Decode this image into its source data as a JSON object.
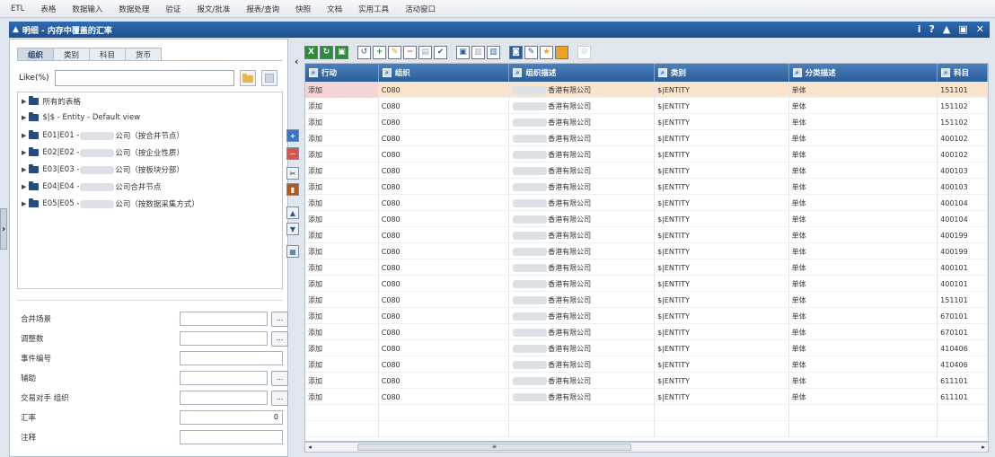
{
  "menu": [
    "ETL",
    "表格",
    "数据输入",
    "数据处理",
    "验证",
    "报文/批准",
    "报表/查询",
    "快照",
    "文档",
    "实用工具",
    "活动窗口"
  ],
  "panel": {
    "title": "明细 - 内存中覆盖的汇率",
    "tools": [
      "i",
      "?",
      "▲",
      "▣",
      "✕"
    ]
  },
  "left": {
    "tabs": [
      "组织",
      "类别",
      "科目",
      "货币"
    ],
    "like_label": "Like(%)",
    "like_value": "",
    "tree": [
      {
        "label": "所有的表格",
        "blur": false,
        "suffix": ""
      },
      {
        "label": "$|$ - Entity - Default view",
        "blur": false,
        "suffix": ""
      },
      {
        "label": "E01|E01 -",
        "blur": true,
        "suffix": "公司（按合并节点）"
      },
      {
        "label": "E02|E02 -",
        "blur": true,
        "suffix": "公司（按企业性质）"
      },
      {
        "label": "E03|E03 -",
        "blur": true,
        "suffix": "公司（按板块分部）"
      },
      {
        "label": "E04|E04 -",
        "blur": true,
        "suffix": "公司合并节点"
      },
      {
        "label": "E05|E05 -",
        "blur": true,
        "suffix": "公司（按数据采集方式）"
      }
    ],
    "fields": [
      {
        "label": "合并场景",
        "value": "",
        "lookup": "..."
      },
      {
        "label": "调整数",
        "value": "",
        "lookup": "..."
      },
      {
        "label": "事件编号",
        "value": "",
        "lookup": ""
      },
      {
        "label": "辅助",
        "value": "",
        "lookup": "..."
      },
      {
        "label": "交易对手 组织",
        "value": "",
        "lookup": "..."
      },
      {
        "label": "汇率",
        "value": "0",
        "lookup": ""
      },
      {
        "label": "注释",
        "value": "",
        "lookup": ""
      }
    ]
  },
  "grid": {
    "columns": [
      "行动",
      "组织",
      "组织描述",
      "类别",
      "分类描述",
      "科目"
    ],
    "rows": [
      {
        "action": "添加",
        "org": "C080",
        "desc": "香港有限公司",
        "cat": "$|ENTITY",
        "cdesc": "单体",
        "acct": "151101"
      },
      {
        "action": "添加",
        "org": "C080",
        "desc": "香港有限公司",
        "cat": "$|ENTITY",
        "cdesc": "单体",
        "acct": "151102"
      },
      {
        "action": "添加",
        "org": "C080",
        "desc": "香港有限公司",
        "cat": "$|ENTITY",
        "cdesc": "单体",
        "acct": "151102"
      },
      {
        "action": "添加",
        "org": "C080",
        "desc": "香港有限公司",
        "cat": "$|ENTITY",
        "cdesc": "单体",
        "acct": "400102"
      },
      {
        "action": "添加",
        "org": "C080",
        "desc": "香港有限公司",
        "cat": "$|ENTITY",
        "cdesc": "单体",
        "acct": "400102"
      },
      {
        "action": "添加",
        "org": "C080",
        "desc": "香港有限公司",
        "cat": "$|ENTITY",
        "cdesc": "单体",
        "acct": "400103"
      },
      {
        "action": "添加",
        "org": "C080",
        "desc": "香港有限公司",
        "cat": "$|ENTITY",
        "cdesc": "单体",
        "acct": "400103"
      },
      {
        "action": "添加",
        "org": "C080",
        "desc": "香港有限公司",
        "cat": "$|ENTITY",
        "cdesc": "单体",
        "acct": "400104"
      },
      {
        "action": "添加",
        "org": "C080",
        "desc": "香港有限公司",
        "cat": "$|ENTITY",
        "cdesc": "单体",
        "acct": "400104"
      },
      {
        "action": "添加",
        "org": "C080",
        "desc": "香港有限公司",
        "cat": "$|ENTITY",
        "cdesc": "单体",
        "acct": "400199"
      },
      {
        "action": "添加",
        "org": "C080",
        "desc": "香港有限公司",
        "cat": "$|ENTITY",
        "cdesc": "单体",
        "acct": "400199"
      },
      {
        "action": "添加",
        "org": "C080",
        "desc": "香港有限公司",
        "cat": "$|ENTITY",
        "cdesc": "单体",
        "acct": "400101"
      },
      {
        "action": "添加",
        "org": "C080",
        "desc": "香港有限公司",
        "cat": "$|ENTITY",
        "cdesc": "单体",
        "acct": "400101"
      },
      {
        "action": "添加",
        "org": "C080",
        "desc": "香港有限公司",
        "cat": "$|ENTITY",
        "cdesc": "单体",
        "acct": "151101"
      },
      {
        "action": "添加",
        "org": "C080",
        "desc": "香港有限公司",
        "cat": "$|ENTITY",
        "cdesc": "单体",
        "acct": "670101"
      },
      {
        "action": "添加",
        "org": "C080",
        "desc": "香港有限公司",
        "cat": "$|ENTITY",
        "cdesc": "单体",
        "acct": "670101"
      },
      {
        "action": "添加",
        "org": "C080",
        "desc": "香港有限公司",
        "cat": "$|ENTITY",
        "cdesc": "单体",
        "acct": "410406"
      },
      {
        "action": "添加",
        "org": "C080",
        "desc": "香港有限公司",
        "cat": "$|ENTITY",
        "cdesc": "单体",
        "acct": "410406"
      },
      {
        "action": "添加",
        "org": "C080",
        "desc": "香港有限公司",
        "cat": "$|ENTITY",
        "cdesc": "单体",
        "acct": "611101"
      },
      {
        "action": "添加",
        "org": "C080",
        "desc": "香港有限公司",
        "cat": "$|ENTITY",
        "cdesc": "单体",
        "acct": "611101"
      }
    ],
    "scroll_thumb_label": "≡"
  },
  "colors": {
    "header_blue": "#2a5d98",
    "selected_row": "#fbe4cc",
    "selected_action": "#f3d6d3"
  }
}
